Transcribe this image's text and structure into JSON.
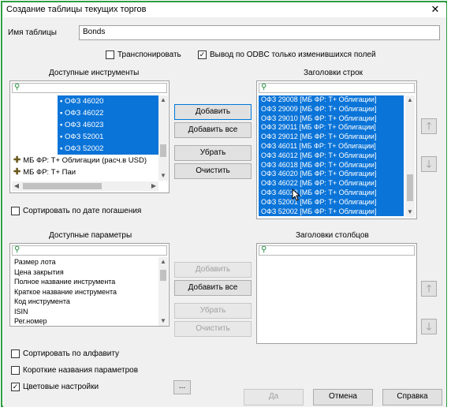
{
  "window": {
    "title": "Создание таблицы текущих торгов",
    "close_glyph": "✕"
  },
  "table_name": {
    "label": "Имя таблицы",
    "value": "Bonds"
  },
  "options": {
    "transpose_label": "Транспонировать",
    "transpose_checked": false,
    "odbc_label": "Вывод по ODBC только изменившихся  полей",
    "odbc_checked": true
  },
  "available_instruments": {
    "header": "Доступные инструменты",
    "items": [
      "ОФЗ 46020",
      "ОФЗ 46022",
      "ОФЗ 46023",
      "ОФЗ 52001",
      "ОФЗ 52002"
    ],
    "groups": [
      "МБ ФР: Т+ Облигации (расч.в USD)",
      "МБ ФР: Т+ Паи"
    ],
    "sort_by_maturity_label": "Сортировать по дате погашения"
  },
  "instrument_buttons": {
    "add": "Добавить",
    "add_all": "Добавить все",
    "remove": "Убрать",
    "clear": "Очистить"
  },
  "row_headers": {
    "header": "Заголовки строк",
    "items": [
      "ОФЗ 29008 [МБ ФР: Т+ Облигации]",
      "ОФЗ 29009 [МБ ФР: Т+ Облигации]",
      "ОФЗ 29010 [МБ ФР: Т+ Облигации]",
      "ОФЗ 29011 [МБ ФР: Т+ Облигации]",
      "ОФЗ 29012 [МБ ФР: Т+ Облигации]",
      "ОФЗ 46011 [МБ ФР: Т+ Облигации]",
      "ОФЗ 46012 [МБ ФР: Т+ Облигации]",
      "ОФЗ 46018 [МБ ФР: Т+ Облигации]",
      "ОФЗ 46020 [МБ ФР: Т+ Облигации]",
      "ОФЗ 46022 [МБ ФР: Т+ Облигации]",
      "ОФЗ 46023 [МБ ФР: Т+ Облигации]",
      "ОФЗ 52001 [МБ ФР: Т+ Облигации]",
      "ОФЗ 52002 [МБ ФР: Т+ Облигации]"
    ]
  },
  "available_parameters": {
    "header": "Доступные параметры",
    "items": [
      "Размер лота",
      "Цена закрытия",
      "Полное название инструмента",
      "Краткое название инструмента",
      "Код инструмента",
      "ISIN",
      "Рег.номер"
    ]
  },
  "parameter_buttons": {
    "add": "Добавить",
    "add_all": "Добавить все",
    "remove": "Убрать",
    "clear": "Очистить"
  },
  "column_headers": {
    "header": "Заголовки столбцов"
  },
  "bottom_options": {
    "sort_alpha_label": "Сортировать по алфавиту",
    "sort_alpha_checked": false,
    "short_names_label": "Короткие названия параметров",
    "short_names_checked": false,
    "color_settings_label": "Цветовые настройки",
    "color_settings_checked": true,
    "more_button": "..."
  },
  "dialog_buttons": {
    "yes": "Да",
    "cancel": "Отмена",
    "help": "Справка"
  },
  "icons": {
    "search": "search-icon",
    "up": "arrow-up-icon",
    "down": "arrow-down-icon",
    "group": "plus-icon"
  },
  "colors": {
    "selection": "#0b74d8",
    "frame": "#2f9e44"
  }
}
